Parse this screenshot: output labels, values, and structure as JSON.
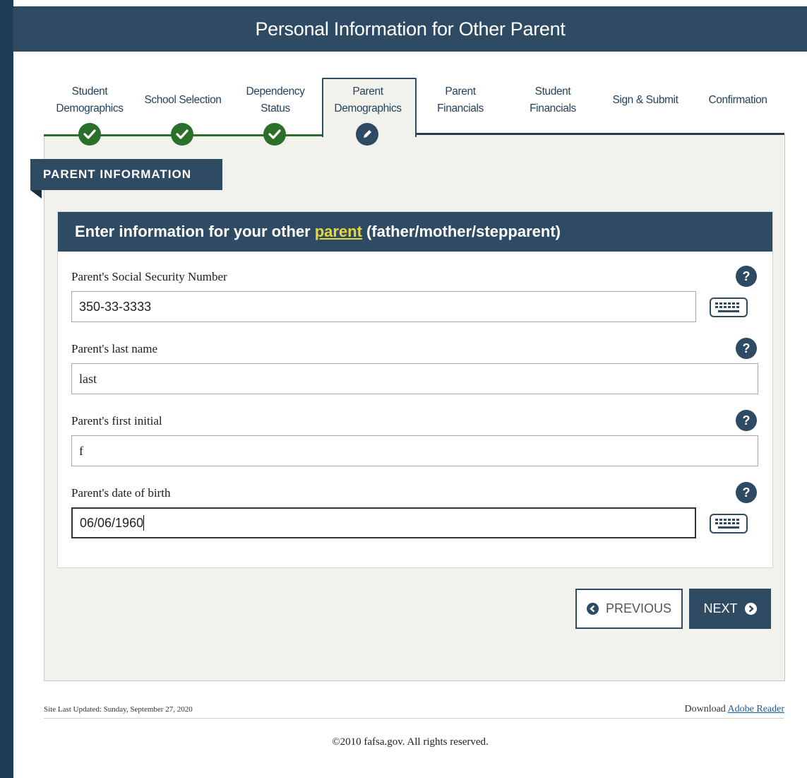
{
  "header": {
    "title": "Personal Information for Other Parent"
  },
  "steps": [
    {
      "label": "Student Demographics",
      "status": "complete"
    },
    {
      "label": "School Selection",
      "status": "complete"
    },
    {
      "label": "Dependency Status",
      "status": "complete"
    },
    {
      "label": "Parent Demographics",
      "status": "current"
    },
    {
      "label": "Parent Financials",
      "status": "pending"
    },
    {
      "label": "Student Financials",
      "status": "pending"
    },
    {
      "label": "Sign & Submit",
      "status": "pending"
    },
    {
      "label": "Confirmation",
      "status": "pending"
    }
  ],
  "section": {
    "title": "PARENT INFORMATION"
  },
  "form": {
    "heading_prefix": "Enter information for your other",
    "heading_link": "parent",
    "heading_suffix": "(father/mother/stepparent)",
    "fields": [
      {
        "label": "Parent's Social Security Number",
        "value": "350-33-3333"
      },
      {
        "label": "Parent's last name",
        "value": "last"
      },
      {
        "label": "Parent's first initial",
        "value": "f"
      },
      {
        "label": "Parent's date of birth",
        "value": "06/06/1960"
      }
    ],
    "help_symbol": "?"
  },
  "buttons": {
    "previous": "PREVIOUS",
    "next": "NEXT"
  },
  "footer": {
    "updated": "Site Last Updated: Sunday, September 27, 2020",
    "download_prefix": "Download",
    "download_link": "Adobe Reader",
    "copyright": "©2010 fafsa.gov. All rights reserved."
  },
  "colors": {
    "navy": "#2f4b63",
    "green": "#2a6f2a",
    "link_yellow": "#e8d63a",
    "panel": "#f2f2ed"
  }
}
